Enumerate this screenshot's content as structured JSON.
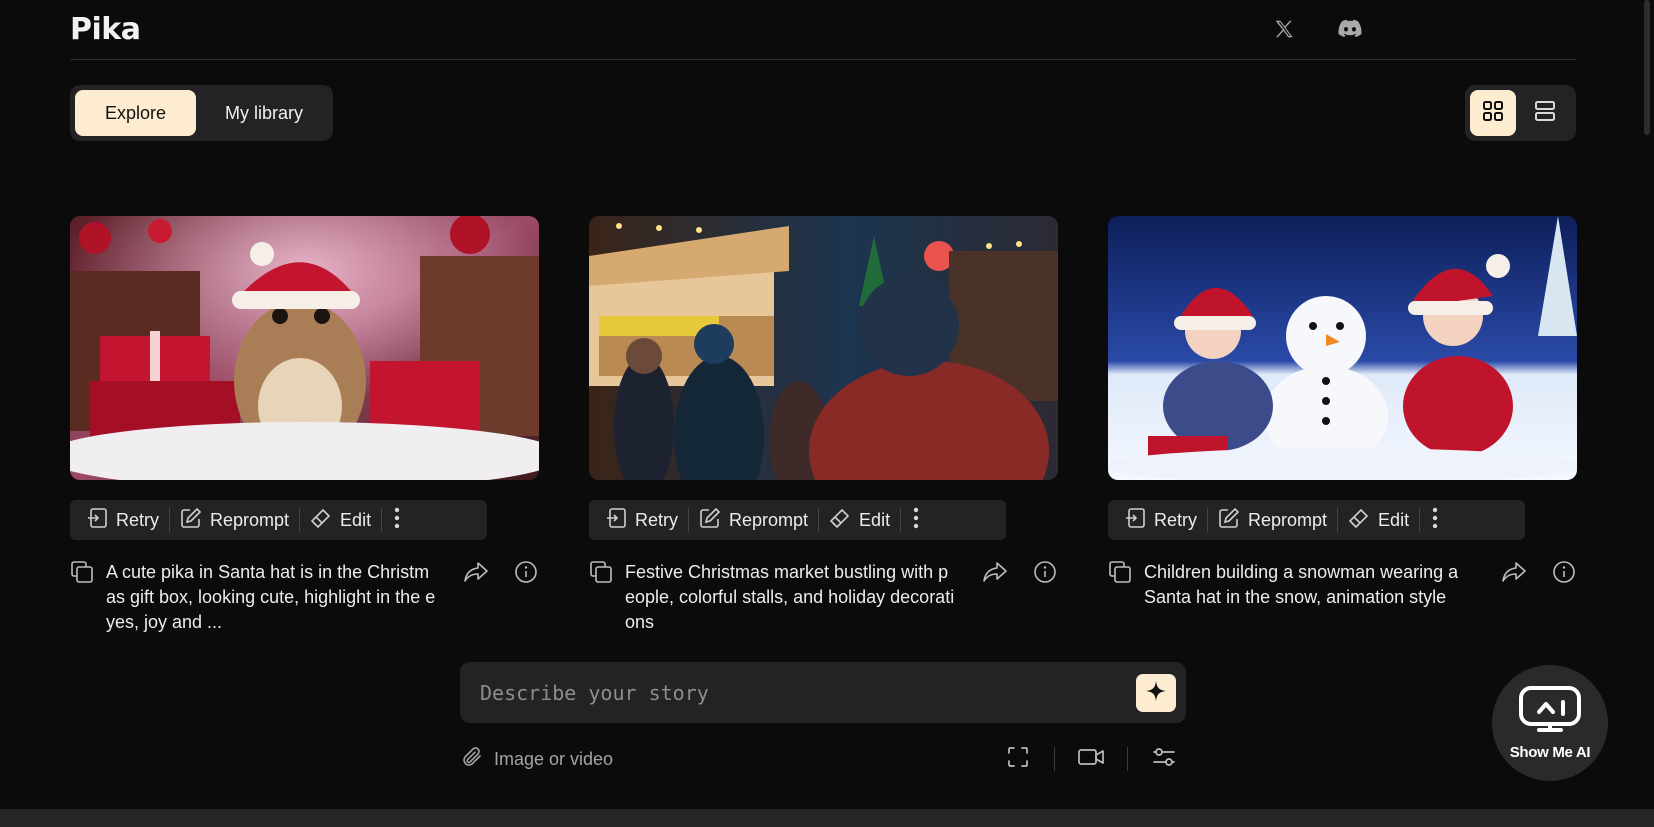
{
  "header": {
    "logo": "Pika"
  },
  "tabs": {
    "explore": "Explore",
    "library": "My library"
  },
  "cards": [
    {
      "prompt": "A cute pika in Santa hat is in the Christmas gift box, looking cute, highlight in the eyes, joy and ...",
      "retry": "Retry",
      "reprompt": "Reprompt",
      "edit": "Edit"
    },
    {
      "prompt": "Festive Christmas market bustling with people, colorful stalls, and holiday decorations",
      "retry": "Retry",
      "reprompt": "Reprompt",
      "edit": "Edit"
    },
    {
      "prompt": "Children building a snowman wearing a Santa hat in the snow, animation style",
      "retry": "Retry",
      "reprompt": "Reprompt",
      "edit": "Edit"
    }
  ],
  "story": {
    "placeholder": "Describe your story"
  },
  "attach": {
    "label": "Image or video"
  },
  "badge": {
    "label": "Show Me AI"
  },
  "colors": {
    "accent": "#fdecd0",
    "background": "#0b0b0c",
    "panel": "#232325"
  }
}
